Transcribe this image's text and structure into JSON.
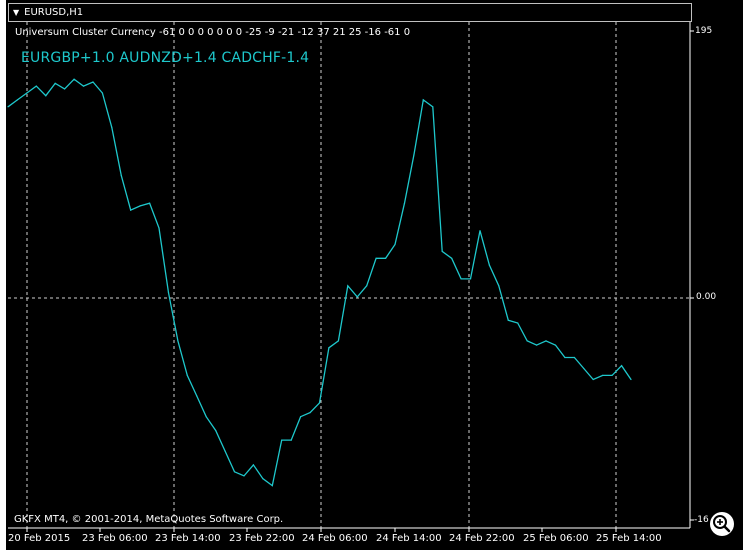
{
  "chart_header": {
    "symbol": "EURUSD,H1",
    "dropdown_icon": "triangle-down-icon"
  },
  "indicator": {
    "label": "Universum Cluster Currency -61 0 0 0 0 0 0 0 -25 -9 -21 -12 37 21 25 -16 -61 0",
    "pairs": "EURGBP+1.0 AUDNZD+1.4 CADCHF-1.4",
    "line_color": "#1ec8cc"
  },
  "price_axis": {
    "top_label": "195",
    "mid_label": "0.00",
    "bottom_label": "-16"
  },
  "time_axis": {
    "labels": [
      "20 Feb 2015",
      "23 Feb 06:00",
      "23 Feb 14:00",
      "23 Feb 22:00",
      "24 Feb 06:00",
      "24 Feb 14:00",
      "24 Feb 22:00",
      "25 Feb 06:00",
      "25 Feb 14:00"
    ]
  },
  "footer": {
    "copyright": "GKFX MT4, © 2001-2014, MetaQuotes Software Corp."
  },
  "zoom_icon": "magnifier-plus-icon",
  "chart_data": {
    "type": "line",
    "title": "",
    "grid": true,
    "ylim": [
      -160,
      195
    ],
    "series": [
      {
        "values": [
          140,
          145,
          150,
          155,
          148,
          157,
          153,
          160,
          155,
          158,
          150,
          125,
          90,
          65,
          68,
          70,
          52,
          5,
          -30,
          -55,
          -70,
          -85,
          -95,
          -110,
          -125,
          -128,
          -120,
          -130,
          -135,
          -102,
          -102,
          -85,
          -82,
          -75,
          -35,
          -30,
          10,
          2,
          10,
          30,
          30,
          40,
          70,
          105,
          145,
          140,
          35,
          30,
          15,
          15,
          50,
          25,
          10,
          -15,
          -17,
          -30,
          -33,
          -30,
          -33,
          -42,
          -42,
          -50,
          -58,
          -55,
          -55,
          -48,
          -58
        ]
      }
    ]
  }
}
